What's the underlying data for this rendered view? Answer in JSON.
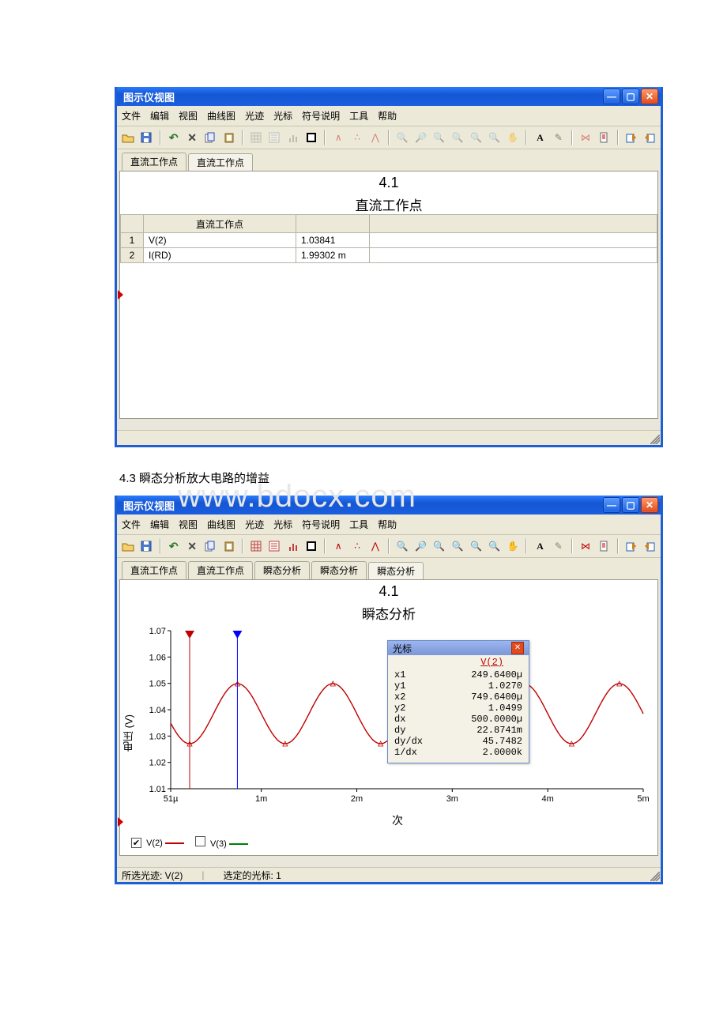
{
  "watermark": "www.bdocx.com",
  "section_caption": "4.3 瞬态分析放大电路的增益",
  "win1": {
    "title": "图示仪视图",
    "menus": [
      "文件",
      "编辑",
      "视图",
      "曲线图",
      "光迹",
      "光标",
      "符号说明",
      "工具",
      "帮助"
    ],
    "tabs": [
      "直流工作点",
      "直流工作点"
    ],
    "chart_heading": "4.1",
    "chart_sub": "直流工作点",
    "col_header": "直流工作点",
    "rows": [
      {
        "idx": "1",
        "name": "V(2)",
        "val": "1.03841"
      },
      {
        "idx": "2",
        "name": "I(RD)",
        "val": "1.99302 m"
      }
    ]
  },
  "win2": {
    "title": "图示仪视图",
    "menus": [
      "文件",
      "编辑",
      "视图",
      "曲线图",
      "光迹",
      "光标",
      "符号说明",
      "工具",
      "帮助"
    ],
    "tabs": [
      "直流工作点",
      "直流工作点",
      "瞬态分析",
      "瞬态分析",
      "瞬态分析"
    ],
    "chart_heading": "4.1",
    "chart_sub": "瞬态分析",
    "ylabel": "电压 (V)",
    "xlabel": "次",
    "xticks": [
      "51µ",
      "1m",
      "2m",
      "3m",
      "4m",
      "5m"
    ],
    "yticks": [
      "1.01",
      "1.02",
      "1.03",
      "1.04",
      "1.05",
      "1.06",
      "1.07"
    ],
    "legend": [
      {
        "name": "V(2)",
        "color": "#c00000",
        "checked": true
      },
      {
        "name": "V(3)",
        "color": "#008000",
        "checked": false
      }
    ],
    "cursor": {
      "title": "光标",
      "series": "V(2)",
      "rows": [
        {
          "k": "x1",
          "v": "249.6400µ"
        },
        {
          "k": "y1",
          "v": "1.0270"
        },
        {
          "k": "x2",
          "v": "749.6400µ"
        },
        {
          "k": "y2",
          "v": "1.0499"
        },
        {
          "k": "dx",
          "v": "500.0000µ"
        },
        {
          "k": "dy",
          "v": "22.8741m"
        },
        {
          "k": "dy/dx",
          "v": "45.7482"
        },
        {
          "k": "1/dx",
          "v": "2.0000k"
        }
      ]
    },
    "status": {
      "trace": "所选光迹: V(2)",
      "cursor": "选定的光标: 1"
    }
  },
  "chart_data": {
    "type": "line",
    "title": "4.1 瞬态分析",
    "xlabel": "次",
    "ylabel": "电压 (V)",
    "x_range_ms": [
      0.051,
      5.0
    ],
    "y_range": [
      1.01,
      1.07
    ],
    "series": [
      {
        "name": "V(2)",
        "color": "#c00000",
        "period_ms": 1.0,
        "amplitude": 0.0114,
        "offset": 1.0385,
        "phase_deg": 0,
        "sample_points_ms_V": [
          [
            0.0516,
            1.035
          ],
          [
            0.25,
            1.027
          ],
          [
            0.5,
            1.038
          ],
          [
            0.75,
            1.05
          ],
          [
            1.0,
            1.038
          ],
          [
            1.25,
            1.027
          ],
          [
            1.5,
            1.038
          ],
          [
            1.75,
            1.05
          ],
          [
            2.0,
            1.038
          ],
          [
            2.25,
            1.027
          ],
          [
            2.5,
            1.038
          ],
          [
            2.75,
            1.05
          ],
          [
            3.0,
            1.038
          ],
          [
            3.25,
            1.027
          ],
          [
            3.5,
            1.038
          ],
          [
            3.75,
            1.05
          ],
          [
            4.0,
            1.038
          ],
          [
            4.25,
            1.027
          ],
          [
            4.5,
            1.038
          ],
          [
            4.75,
            1.05
          ],
          [
            5.0,
            1.038
          ]
        ]
      }
    ],
    "cursors": [
      {
        "id": 1,
        "x_ms": 0.2496,
        "y": 1.027,
        "color": "#c00000"
      },
      {
        "id": 2,
        "x_ms": 0.7496,
        "y": 1.0499,
        "color": "#0000ff"
      }
    ],
    "cursor_diff": {
      "dx_ms": 0.5,
      "dy": 0.0228741,
      "dydx": 45.7482,
      "one_over_dx": 2000
    }
  }
}
